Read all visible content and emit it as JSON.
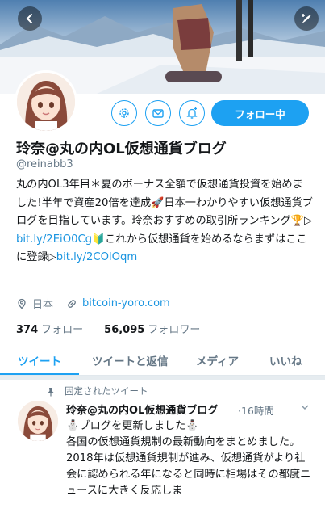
{
  "header": {
    "back_icon": "chevron-left-icon",
    "compose_icon": "compose-icon"
  },
  "profile": {
    "name": "玲奈@丸の内OL仮想通貨ブログ",
    "handle": "@reinabb3",
    "follow_label": "フォロー中",
    "bio_parts": {
      "line1": "丸の内OL3年目＊夏のボーナス全額で仮想通貨投資を始めました!半年で資産20倍を達成",
      "rocket": "🚀",
      "line2": "日本一わかりやすい仮想通貨ブログを目指しています。玲奈おすすめの取引所ランキング",
      "trophy": "🏆",
      "arrow1": "▷ ",
      "link1": "bit.ly/2EiO0Cg",
      "beginner": "🔰",
      "line3": "これから仮想通貨を始めるならまずはここに登録▷",
      "link2": "bit.ly/2COlOqm"
    },
    "location": "日本",
    "website": "bitcoin-yoro.com",
    "following_count": "374",
    "following_label": "フォロー",
    "followers_count": "56,095",
    "followers_label": "フォロワー"
  },
  "tabs": [
    {
      "label": "ツイート",
      "active": true
    },
    {
      "label": "ツイートと返信",
      "active": false
    },
    {
      "label": "メディア",
      "active": false
    },
    {
      "label": "いいね",
      "active": false
    }
  ],
  "tweet": {
    "pinned_label": "固定されたツイート",
    "author": "玲奈@丸の内OL仮想通貨ブログ",
    "time_sep": "·",
    "time": "16時間",
    "line1": "⛄ブログを更新しました⛄",
    "line2": "各国の仮想通貨規制の最新動向をまとめました。",
    "line3": "2018年は仮想通貨規制が進み、仮想通貨がより社会に認められる年になると同時に相場はその都度ニュースに大きく反応しま"
  },
  "colors": {
    "accent": "#1da1f2",
    "link": "#1b95e0",
    "muted": "#657786"
  }
}
